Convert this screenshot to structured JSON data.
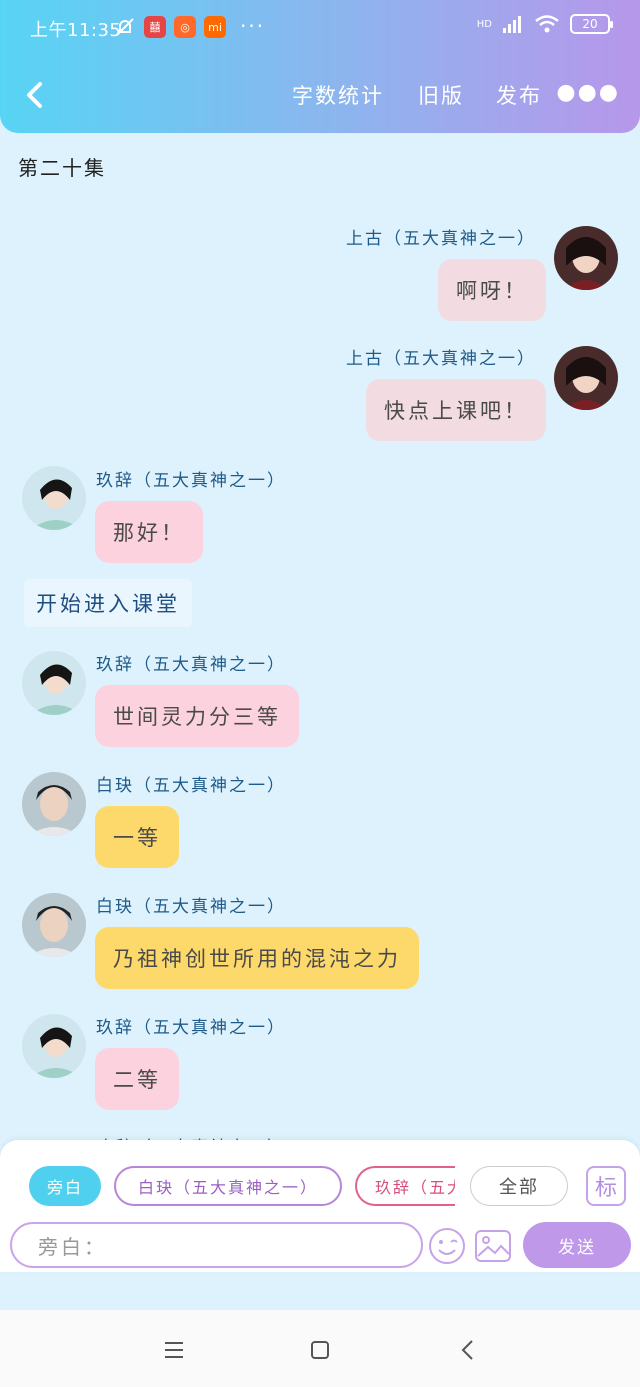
{
  "status_bar": {
    "time": "上午11:35",
    "battery": "20",
    "network": "HD"
  },
  "nav": {
    "word_count": "字数统计",
    "old_version": "旧版",
    "publish": "发布",
    "more": "●●●"
  },
  "episode_title": "第二十集",
  "messages": [
    {
      "speaker": "上古（五大真神之一）",
      "text": "啊呀！",
      "side": "right",
      "bubble_color": "#f2dce2"
    },
    {
      "speaker": "上古（五大真神之一）",
      "text": "快点上课吧！",
      "side": "right",
      "bubble_color": "#f2dce2"
    },
    {
      "speaker": "玖辞（五大真神之一）",
      "text": "那好！",
      "side": "left",
      "bubble_color": "#fbd2de"
    },
    {
      "speaker": "玖辞（五大真神之一）",
      "text": "世间灵力分三等",
      "side": "left",
      "bubble_color": "#fbd2de"
    },
    {
      "speaker": "白玦（五大真神之一）",
      "text": "一等",
      "side": "left",
      "bubble_color": "#fcd96a"
    },
    {
      "speaker": "白玦（五大真神之一）",
      "text": "乃祖神创世所用的混沌之力",
      "side": "left",
      "bubble_color": "#fcd96a"
    },
    {
      "speaker": "玖辞（五大真神之一）",
      "text": "二等",
      "side": "left",
      "bubble_color": "#fbd2de"
    }
  ],
  "narration": "开始进入课堂",
  "partial_speaker": "玖辞（五大真神之一）",
  "chips": {
    "narrator": "旁白",
    "baijue": "白玦（五大真神之一）",
    "jiuci": "玖辞（五大真神之一）",
    "all": "全部",
    "mark": "标"
  },
  "input": {
    "placeholder": "旁白："
  },
  "send": "发送",
  "colors": {
    "accent_purple": "#bf98ea",
    "header_cyan": "#57d4f4",
    "chip_cyan": "#4fd0ef"
  }
}
